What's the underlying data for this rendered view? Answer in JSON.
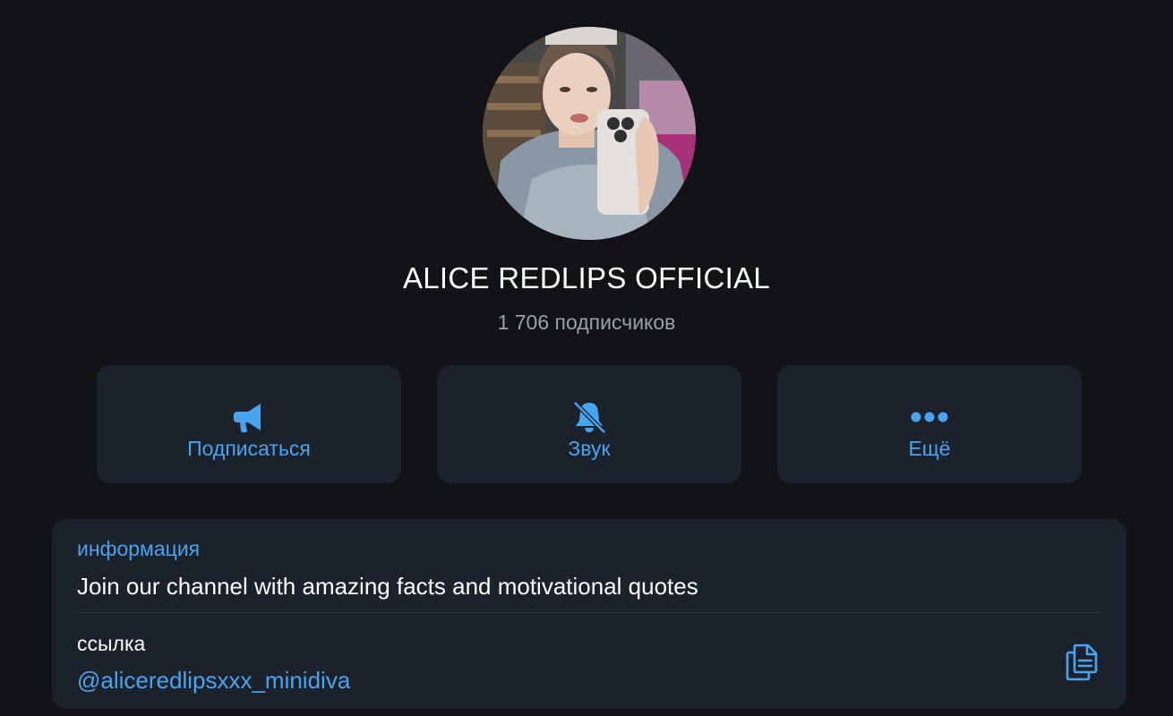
{
  "channel": {
    "title": "ALICE REDLIPS OFFICIAL",
    "subscribers": "1 706 подписчиков",
    "avatar_icon": "profile-photo"
  },
  "actions": [
    {
      "label": "Подписаться",
      "icon": "megaphone-icon"
    },
    {
      "label": "Звук",
      "icon": "bell-muted-icon"
    },
    {
      "label": "Ещё",
      "icon": "more-dots-icon"
    }
  ],
  "info": {
    "heading": "информация",
    "text": "Join our channel with amazing facts and motivational quotes",
    "link_heading": "ссылка",
    "link_value": "@aliceredlipsxxx_minidiva",
    "copy_icon": "copy-icon"
  },
  "colors": {
    "background": "#121316",
    "card": "#1b222b",
    "accent": "#4aa3ef",
    "secondary_text": "#9aa0a8"
  }
}
